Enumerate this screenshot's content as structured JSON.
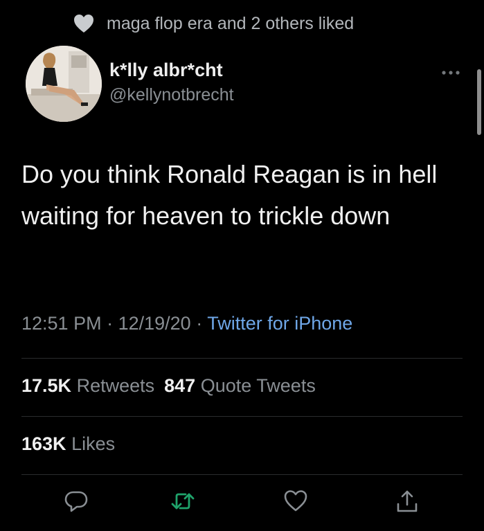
{
  "social_context": {
    "text": "maga flop era and 2 others liked",
    "icon": "heart-icon"
  },
  "author": {
    "display_name": "k*lly albr*cht",
    "handle": "@kellynotbrecht",
    "avatar": "avatar-photo"
  },
  "tweet": {
    "text": "Do you think Ronald Reagan is in hell waiting for heaven to trickle down"
  },
  "meta": {
    "time": "12:51 PM",
    "separator": " · ",
    "date": "12/19/20",
    "source": "Twitter for iPhone"
  },
  "stats": {
    "retweets_count": "17.5K",
    "retweets_label": "Retweets",
    "quotes_count": "847",
    "quotes_label": "Quote Tweets",
    "likes_count": "163K",
    "likes_label": "Likes"
  },
  "actions": [
    {
      "name": "reply",
      "icon": "reply-icon"
    },
    {
      "name": "retweet",
      "icon": "retweet-icon"
    },
    {
      "name": "like",
      "icon": "heart-outline-icon"
    },
    {
      "name": "share",
      "icon": "share-icon"
    }
  ],
  "colors": {
    "background": "#000000",
    "primary_text": "#f0f0f0",
    "secondary_text": "#8a8f94",
    "link": "#6fa7e8",
    "retweet_green": "#1fa36b",
    "divider": "#2a2c2e"
  }
}
